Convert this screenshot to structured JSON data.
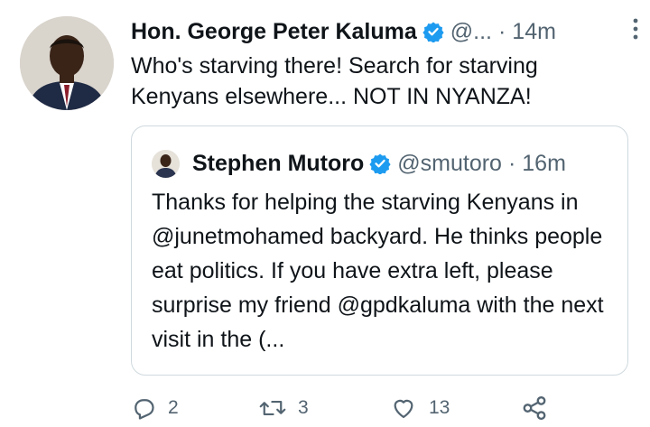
{
  "tweet": {
    "author_name": "Hon. George Peter Kaluma",
    "handle": "@...",
    "separator": "·",
    "time": "14m",
    "text": "Who's starving there! Search for starving Kenyans elsewhere... NOT IN NYANZA!"
  },
  "quote": {
    "author_name": "Stephen Mutoro",
    "handle": "@smutoro",
    "separator": "·",
    "time": "16m",
    "text": "Thanks for helping the starving Kenyans in @junetmohamed backyard. He thinks people eat politics. If you have extra left, please surprise my friend @gpdkaluma with the next visit in the (..."
  },
  "actions": {
    "replies": "2",
    "retweets": "3",
    "likes": "13"
  },
  "colors": {
    "verified": "#1d9bf0",
    "secondary_text": "#536471",
    "border": "#cfd9de"
  }
}
